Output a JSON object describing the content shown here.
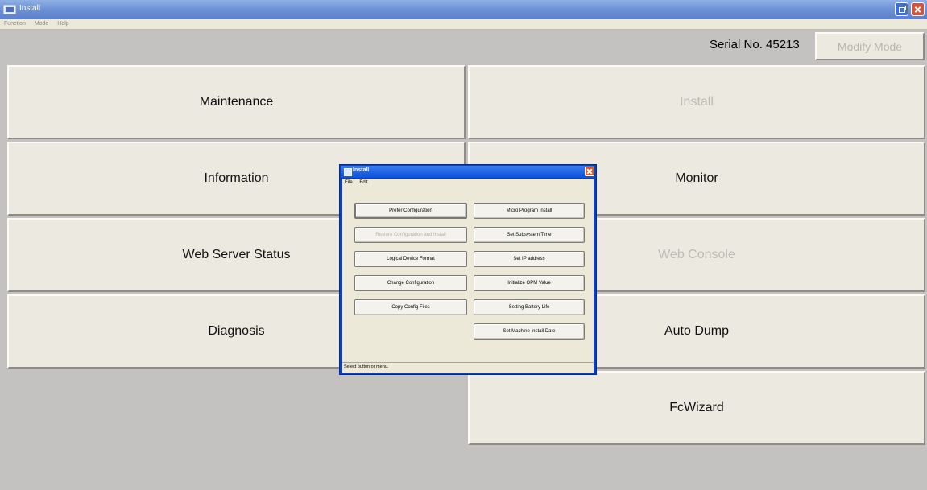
{
  "window": {
    "title": "Install",
    "restore_icon": "restore-icon",
    "close_icon": "close-icon"
  },
  "menubar": {
    "items": [
      "Function",
      "Mode",
      "Help"
    ]
  },
  "header": {
    "serial": "Serial No. 45213",
    "modify_mode": "Modify Mode"
  },
  "main": {
    "maintenance": "Maintenance",
    "install": "Install",
    "information": "Information",
    "monitor": "Monitor",
    "web_server_status": "Web Server Status",
    "web_console": "Web Console",
    "diagnosis": "Diagnosis",
    "auto_dump": "Auto Dump",
    "fcwizard": "FcWizard"
  },
  "dialog": {
    "title": "Install",
    "menu": [
      "File",
      "Edit"
    ],
    "left_buttons": [
      "Prefer Configuration",
      "Restore Configuration and Install",
      "Logical Device Format",
      "Change Configuration",
      "Copy Config Files"
    ],
    "right_buttons": [
      "Micro Program Install",
      "Set Subsystem Time",
      "Set IP address",
      "Initialize OPM Value",
      "Setting Battery Life",
      "Set Machine Install Date"
    ],
    "status": "Select button or menu."
  },
  "colors": {
    "background": "#c4c2c1",
    "button": "#ece9e0",
    "title_bar": "#6f93d6",
    "dialog_frame": "#0a3fc2"
  }
}
